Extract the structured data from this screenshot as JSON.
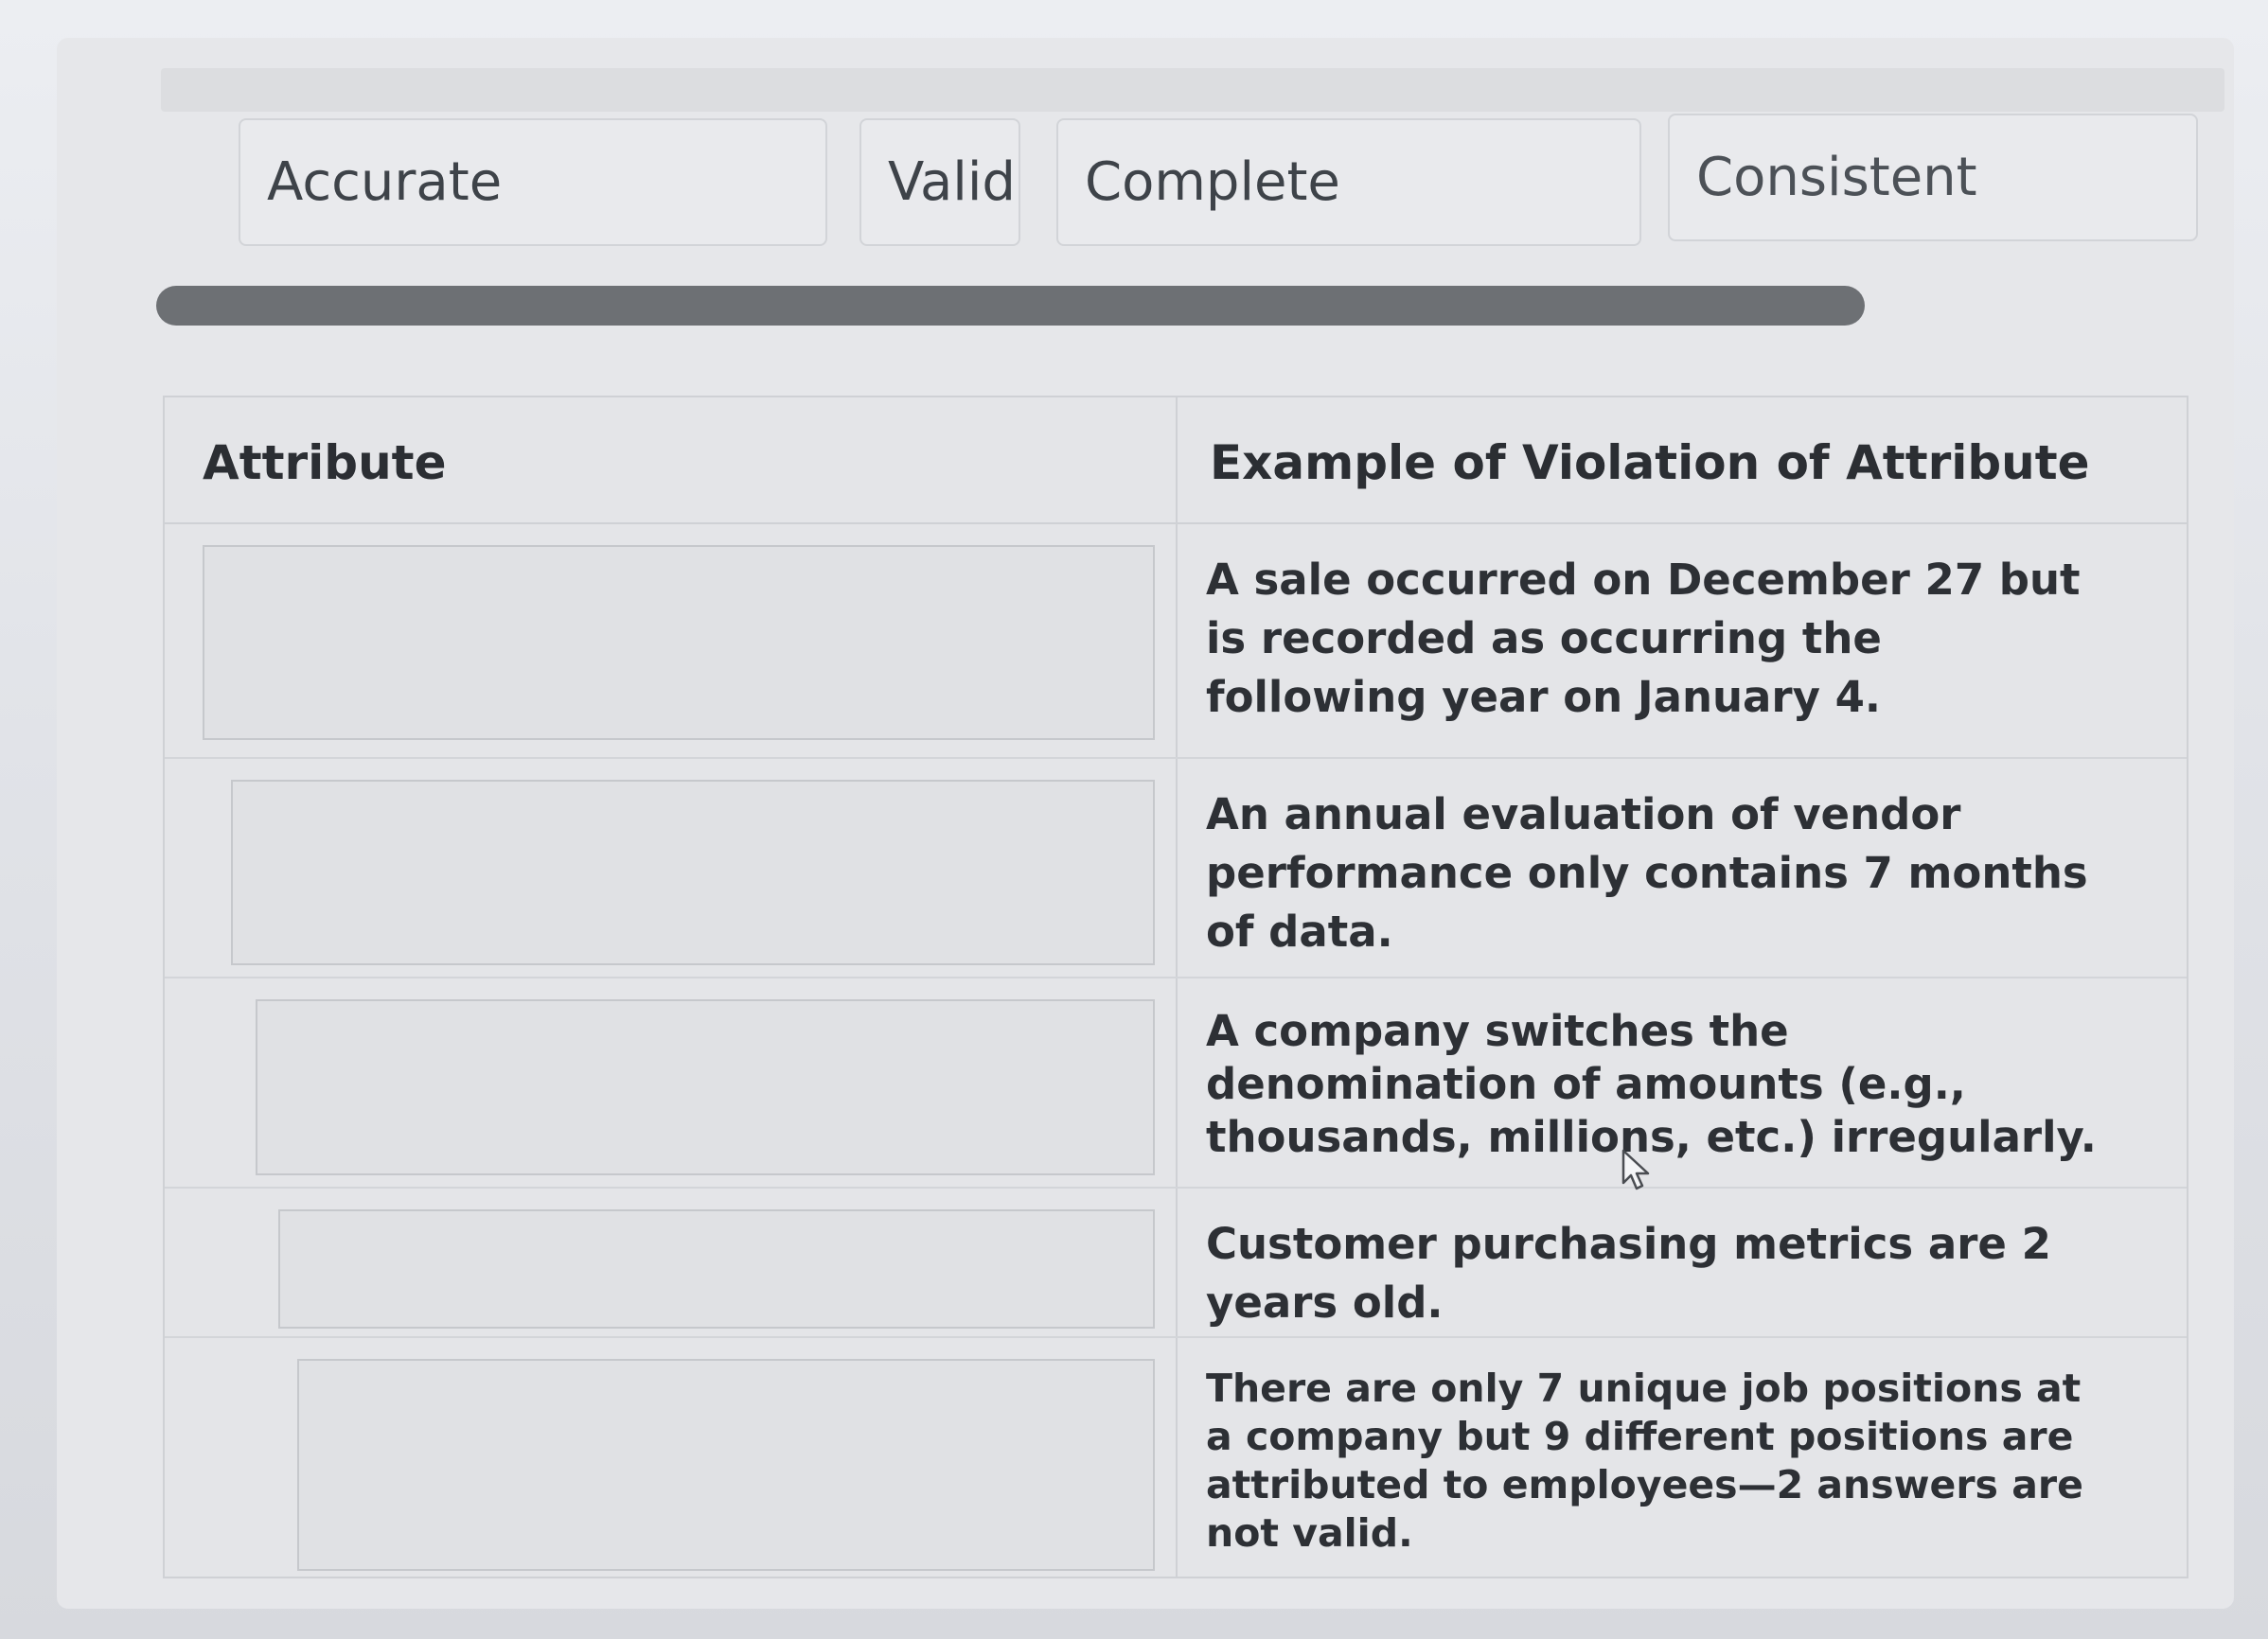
{
  "answer_choices": [
    {
      "id": "accurate",
      "label": "Accurate"
    },
    {
      "id": "valid",
      "label": "Valid"
    },
    {
      "id": "complete",
      "label": "Complete"
    },
    {
      "id": "consistent",
      "label": "Consistent"
    }
  ],
  "table": {
    "header_attribute": "Attribute",
    "header_example": "Example of Violation of Attribute",
    "rows": [
      {
        "attribute": "",
        "example": "A sale occurred on December 27 but is recorded as occurring the following year on January 4."
      },
      {
        "attribute": "",
        "example": "An annual evaluation of vendor performance only contains 7 months of data."
      },
      {
        "attribute": "",
        "example": "A company switches the denomination of amounts (e.g., thousands, millions, etc.) irregularly."
      },
      {
        "attribute": "",
        "example": "Customer purchasing metrics are 2 years old."
      },
      {
        "attribute": "",
        "example": "There are only 7 unique job positions at a company but 9 different positions are attributed to employees—2 answers are not valid."
      }
    ]
  },
  "icons": {
    "cursor": "mouse-pointer-icon"
  }
}
